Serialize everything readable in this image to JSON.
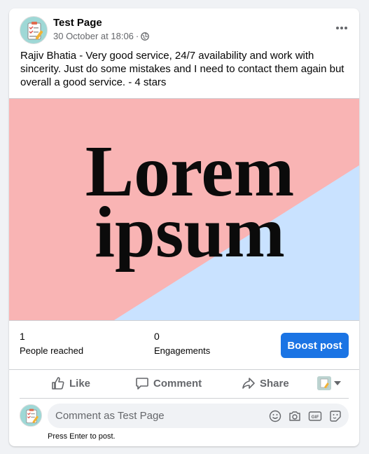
{
  "post": {
    "page_name": "Test Page",
    "timestamp": "30 October at 18:06",
    "separator": "·",
    "privacy_icon": "globe-icon",
    "more_icon": "more-dots-icon",
    "text": "Rajiv Bhatia - Very good service, 24/7 availability and work with sincerity. Just do some mistakes and I need to contact them again but overall a good service. - 4 stars"
  },
  "media": {
    "line1": "Lorem",
    "line2": "ipsum",
    "colors": {
      "pink": "#f9b4b4",
      "blue": "#c9e2ff",
      "text": "#0b0b0b"
    }
  },
  "stats": {
    "reached": {
      "value": "1",
      "label": "People reached"
    },
    "engagements": {
      "value": "0",
      "label": "Engagements"
    },
    "boost_label": "Boost post"
  },
  "actions": {
    "like": {
      "label": "Like",
      "icon": "thumbs-up-icon"
    },
    "comment": {
      "label": "Comment",
      "icon": "comment-bubble-icon"
    },
    "share": {
      "label": "Share",
      "icon": "share-arrow-icon"
    },
    "audience_icon": "page-avatar-icon",
    "dropdown_icon": "caret-down-icon"
  },
  "composer": {
    "placeholder": "Comment as Test Page",
    "hint": "Press Enter to post.",
    "icons": [
      "emoji-icon",
      "camera-icon",
      "gif-icon",
      "sticker-icon"
    ]
  },
  "theme": {
    "accent": "#1b74e4",
    "secondary_text": "#65676b",
    "background": "#f0f2f5"
  }
}
